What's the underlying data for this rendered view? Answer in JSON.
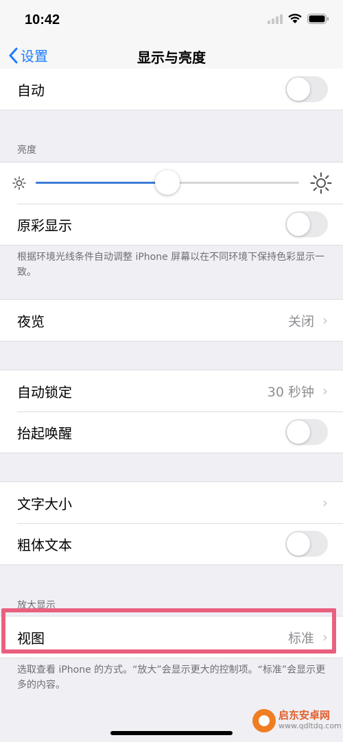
{
  "status": {
    "time": "10:42"
  },
  "nav": {
    "back_label": "设置",
    "title": "显示与亮度"
  },
  "auto_row": {
    "label": "自动",
    "toggle_on": false
  },
  "brightness": {
    "header": "亮度",
    "level": 0.5,
    "true_tone_label": "原彩显示",
    "true_tone_on": false,
    "footer": "根据环境光线条件自动调整 iPhone 屏幕以在不同环境下保持色彩显示一致。"
  },
  "night_shift": {
    "label": "夜览",
    "value": "关闭"
  },
  "lock_group": {
    "auto_lock_label": "自动锁定",
    "auto_lock_value": "30 秒钟",
    "raise_to_wake_label": "抬起唤醒",
    "raise_to_wake_on": false
  },
  "text_group": {
    "text_size_label": "文字大小",
    "bold_text_label": "粗体文本",
    "bold_text_on": false
  },
  "zoom": {
    "header": "放大显示",
    "view_label": "视图",
    "view_value": "标准",
    "footer": "选取查看 iPhone 的方式。“放大”会显示更大的控制项。“标准”会显示更多的内容。"
  },
  "watermark": {
    "name": "启东安卓网",
    "url": "www.qdltdq.com"
  },
  "colors": {
    "accent": "#1a7dfb",
    "highlight": "#e9607f",
    "slider_fill": "#3a7bd5"
  }
}
